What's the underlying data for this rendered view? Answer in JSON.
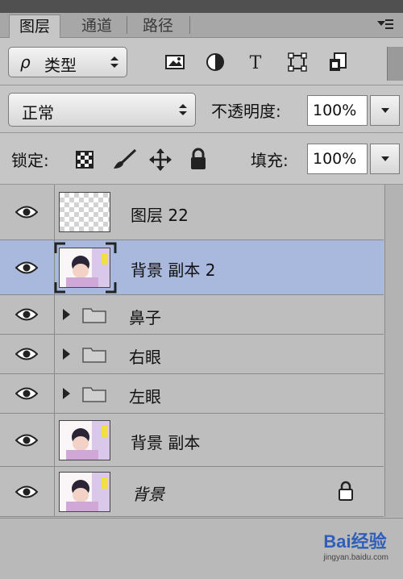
{
  "tabs": [
    {
      "label": "图层",
      "active": true
    },
    {
      "label": "通道",
      "active": false
    },
    {
      "label": "路径",
      "active": false
    }
  ],
  "filter": {
    "search_glyph": "ρ",
    "kind_label": "类型"
  },
  "filter_icons": [
    "image-filter-icon",
    "adjustment-filter-icon",
    "type-filter-icon",
    "shape-filter-icon",
    "smart-object-filter-icon"
  ],
  "blend": {
    "mode": "正常",
    "opacity_label": "不透明度:",
    "opacity": "100%"
  },
  "lock": {
    "label": "锁定:",
    "fill_label": "填充:",
    "fill": "100%"
  },
  "layers": [
    {
      "name": "图层 22",
      "type": "transparent",
      "visible": true,
      "selected": false
    },
    {
      "name": "背景 副本 2",
      "type": "photo",
      "visible": true,
      "selected": true
    },
    {
      "name": "鼻子",
      "type": "group",
      "visible": true,
      "selected": false
    },
    {
      "name": "右眼",
      "type": "group",
      "visible": true,
      "selected": false
    },
    {
      "name": "左眼",
      "type": "group",
      "visible": true,
      "selected": false
    },
    {
      "name": "背景 副本",
      "type": "photo",
      "visible": true,
      "selected": false
    },
    {
      "name": "背景",
      "type": "photo",
      "visible": true,
      "selected": false,
      "locked": true,
      "italic": true
    }
  ],
  "watermark": {
    "text": "Bai经验",
    "sub": "jingyan.baidu.com"
  },
  "colors": {
    "selected_row": "#a9b9dd",
    "panel_bg": "#c6c6c6"
  }
}
